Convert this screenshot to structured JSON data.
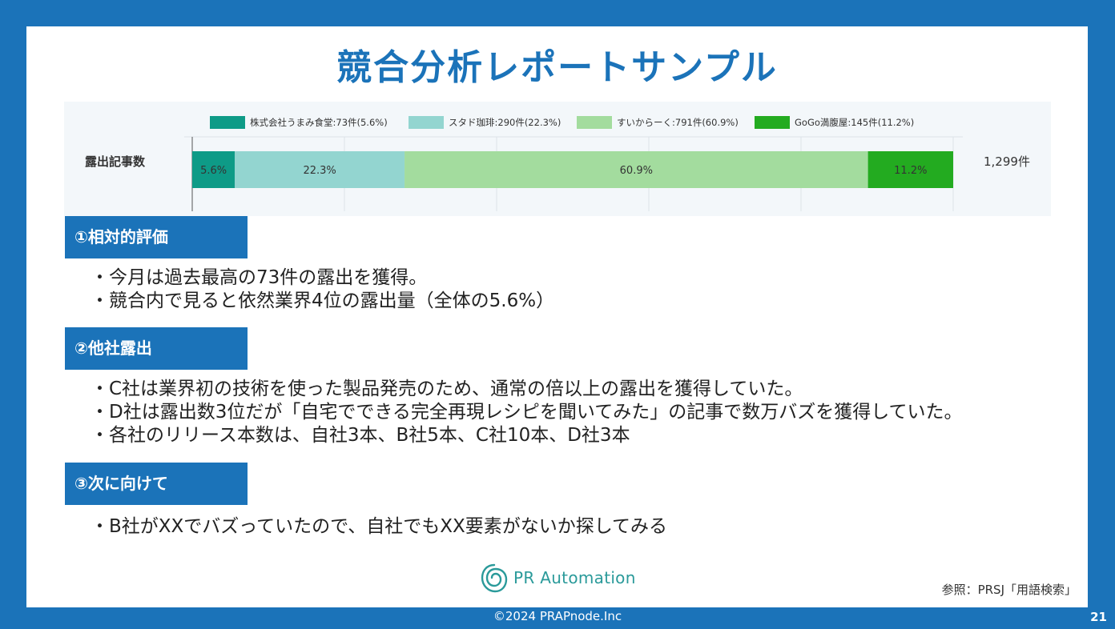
{
  "slide": {
    "title": "競合分析レポートサンプル",
    "reference": "参照：PRSJ「用語検索」",
    "footer": "©2024 PRAPnode.Inc",
    "page_number": "21",
    "logo_text": "PR Automation"
  },
  "sections": [
    {
      "heading": "①相対的評価",
      "bullets": [
        "今月は過去最高の73件の露出を獲得。",
        "競合内で見ると依然業界4位の露出量（全体の5.6%）"
      ]
    },
    {
      "heading": "②他社露出",
      "bullets": [
        "C社は業界初の技術を使った製品発売のため、通常の倍以上の露出を獲得していた。",
        "D社は露出数3位だが「自宅でできる完全再現レシピを聞いてみた」の記事で数万バズを獲得していた。",
        "各社のリリース本数は、自社3本、B社5本、C社10本、D社3本"
      ]
    },
    {
      "heading": "③次に向けて",
      "bullets": [
        "B社がXXでバズっていたので、自社でもXX要素がないか探してみる"
      ]
    }
  ],
  "chart_data": {
    "type": "bar",
    "orientation": "horizontal",
    "stacked": true,
    "categories": [
      "露出記事数"
    ],
    "total_label": "1,299件",
    "xlim": [
      0,
      100
    ],
    "grid": true,
    "legend_position": "top",
    "series": [
      {
        "name": "株式会社うまみ食堂:73件(5.6%)",
        "values": [
          5.6
        ],
        "count": 73,
        "data_label": "5.6%",
        "color": "#0e9b87"
      },
      {
        "name": "スタド珈琲:290件(22.3%)",
        "values": [
          22.3
        ],
        "count": 290,
        "data_label": "22.3%",
        "color": "#93d5d0"
      },
      {
        "name": "すいからーく:791件(60.9%)",
        "values": [
          60.9
        ],
        "count": 791,
        "data_label": "60.9%",
        "color": "#a3dc9e"
      },
      {
        "name": "GoGo満腹屋:145件(11.2%)",
        "values": [
          11.2
        ],
        "count": 145,
        "data_label": "11.2%",
        "color": "#23ab20"
      }
    ]
  }
}
